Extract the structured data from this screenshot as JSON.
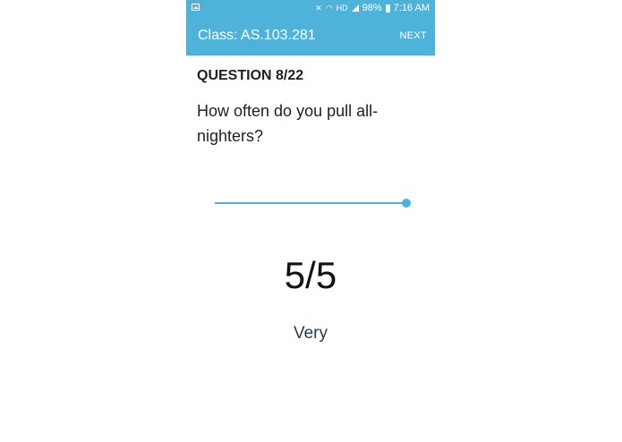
{
  "status_bar": {
    "battery": "98%",
    "time": "7:16 AM",
    "network": "HD",
    "icons": [
      "gallery-icon",
      "mute-icon",
      "wifi-icon",
      "signal-icon",
      "battery-icon"
    ]
  },
  "app_bar": {
    "title": "Class: AS.103.281",
    "next_label": "NEXT",
    "color": "#4fb3d9"
  },
  "question": {
    "number_label": "QUESTION 8/22",
    "text": "How often do you pull all-nighters?"
  },
  "slider": {
    "value": 5,
    "min": 1,
    "max": 5,
    "color": "#4fb3d9"
  },
  "result": {
    "value_text": "5/5",
    "label": "Very"
  }
}
